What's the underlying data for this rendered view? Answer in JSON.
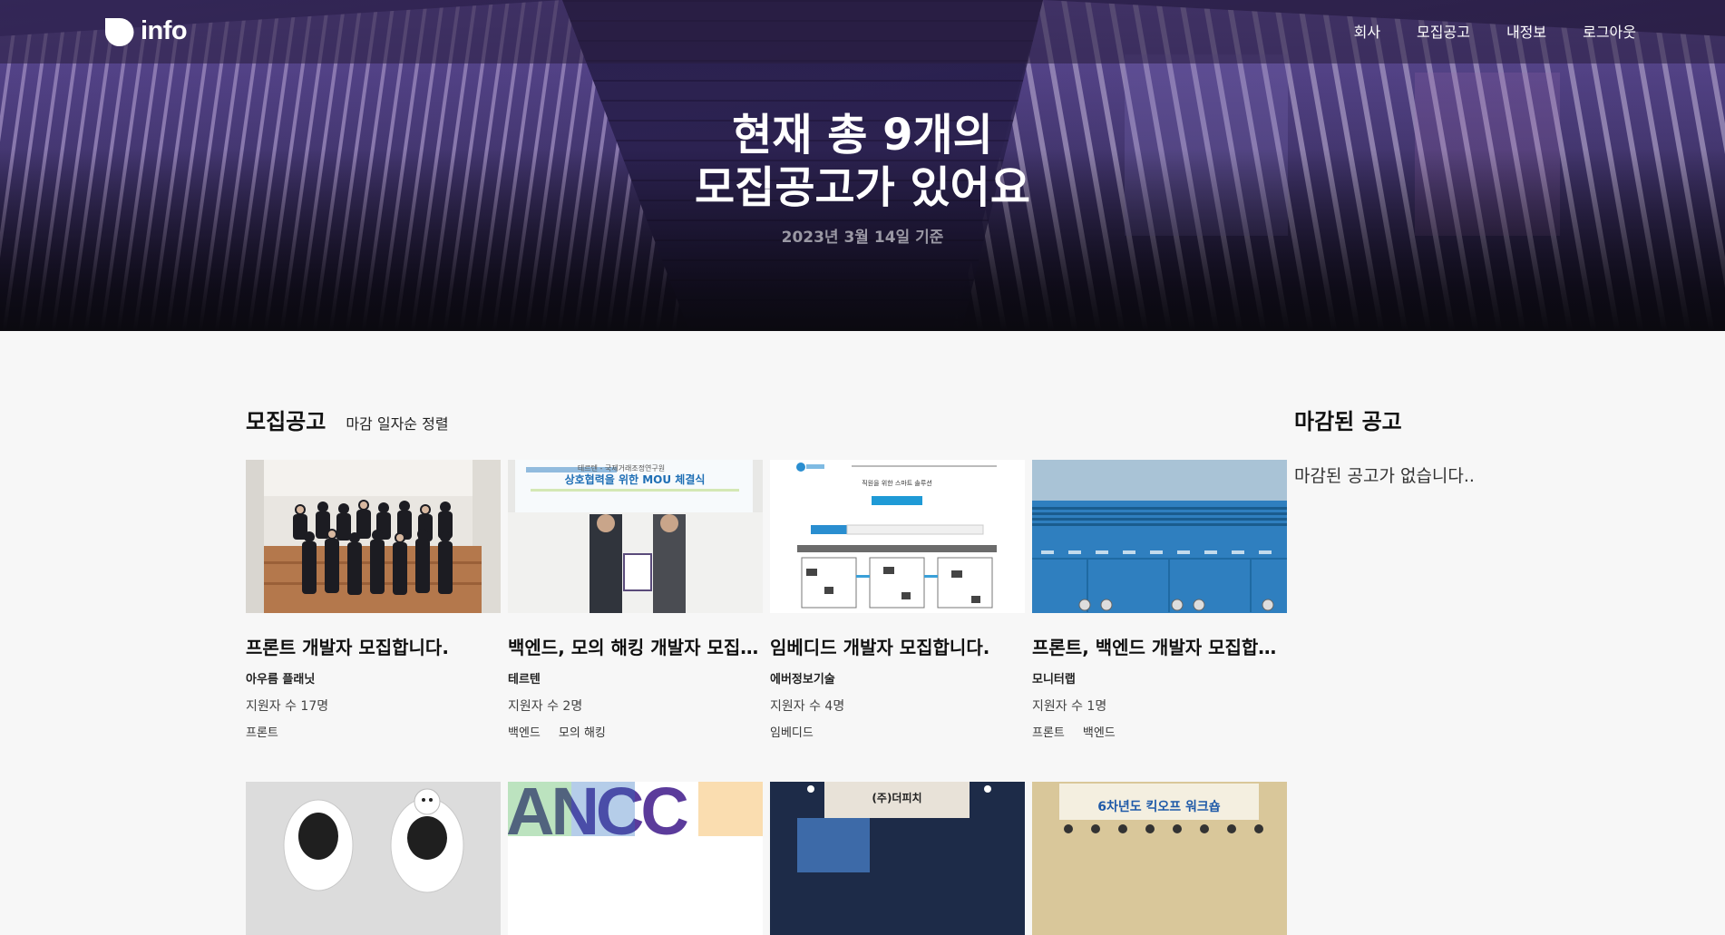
{
  "header": {
    "logo_text": "info",
    "nav": [
      "회사",
      "모집공고",
      "내정보",
      "로그아웃"
    ]
  },
  "hero": {
    "title_line1": "현재 총 9개의",
    "title_line2": "모집공고가 있어요",
    "date": "2023년 3월 14일 기준"
  },
  "postings": {
    "title": "모집공고",
    "sort_label": "마감 일자순 정렬",
    "cards": [
      {
        "title": "프론트 개발자 모집합니다.",
        "company": "아우름 플래닛",
        "applicants": "지원자 수 17명",
        "tags": [
          "프론트"
        ]
      },
      {
        "title": "백엔드, 모의 해킹 개발자 모집합니다.",
        "company": "테르텐",
        "applicants": "지원자 수 2명",
        "tags": [
          "백엔드",
          "모의 해킹"
        ]
      },
      {
        "title": "임베디드 개발자 모집합니다.",
        "company": "에버정보기술",
        "applicants": "지원자 수 4명",
        "tags": [
          "임베디드"
        ]
      },
      {
        "title": "프론트, 백엔드 개발자 모집합니다.",
        "company": "모니터랩",
        "applicants": "지원자 수 1명",
        "tags": [
          "프론트",
          "백엔드"
        ]
      }
    ],
    "image_texts": {
      "mou_banner": "상호협력을 위한 MOU 체결식",
      "mou_sub": "테르텐 - 국제거래조정연구원",
      "security_title": "직원을 위한 스마트 솔루션",
      "ancc": "ANCC",
      "shop_sign": "(주)더피치",
      "kickoff": "6차년도 킥오프 워크숍"
    }
  },
  "closed": {
    "title": "마감된 공고",
    "empty_message": "마감된 공고가 없습니다.."
  }
}
